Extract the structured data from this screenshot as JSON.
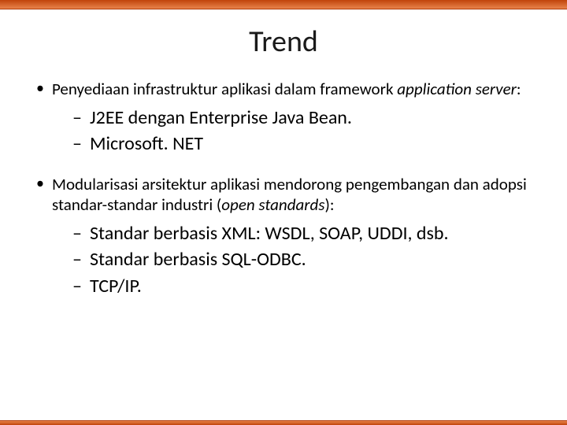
{
  "title": "Trend",
  "bullet1": {
    "text_pre": "Penyediaan infrastruktur aplikasi dalam framework ",
    "text_italic": "application server",
    "text_post": ":",
    "subs": [
      "J2EE dengan Enterprise Java Bean.",
      "Microsoft. NET"
    ]
  },
  "bullet2": {
    "text_pre": "Modularisasi arsitektur aplikasi mendorong pengembangan dan adopsi standar-standar industri (",
    "text_italic": "open standards",
    "text_post": "):",
    "subs": [
      "Standar berbasis XML: WSDL, SOAP, UDDI, dsb.",
      "Standar berbasis SQL-ODBC.",
      "TCP/IP."
    ]
  }
}
